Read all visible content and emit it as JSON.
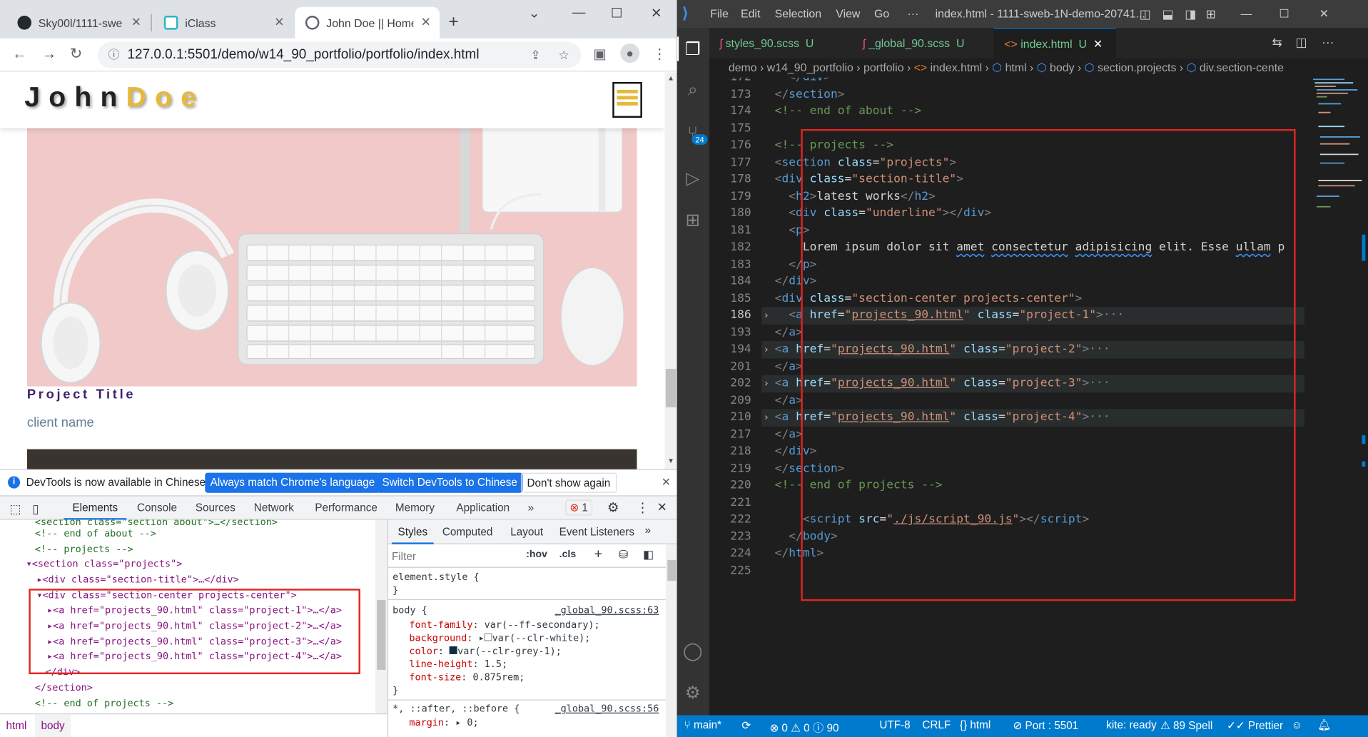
{
  "chrome": {
    "tabs": [
      {
        "title": "Sky00l/1111-swe"
      },
      {
        "title": "iClass"
      },
      {
        "title": "John Doe || Home"
      }
    ],
    "url": "127.0.0.1:5501/demo/w14_90_portfolio/portfolio/index.html",
    "site": {
      "logo_first": "John",
      "logo_last": "Doe",
      "project_title": "Project Title",
      "client_name": "client name"
    },
    "devtools": {
      "banner_text": "DevTools is now available in Chinese!",
      "banner_btn1": "Always match Chrome's language",
      "banner_btn2": "Switch DevTools to Chinese",
      "banner_btn3": "Don't show again",
      "tabs": [
        "Elements",
        "Console",
        "Sources",
        "Network",
        "Performance",
        "Memory",
        "Application"
      ],
      "more_tabs": "»",
      "error_count": "1",
      "dom_lines": [
        {
          "a": "<!-- end of about -->"
        },
        {
          "a": "<!-- projects -->"
        },
        {
          "a": "<section class=\"projects\">"
        },
        {
          "a": "<div class=\"section-title\">…</div>"
        },
        {
          "a": "<div class=\"section-center projects-center\">"
        },
        {
          "a": "<a href=\"projects_90.html\" class=\"project-1\">…</a>"
        },
        {
          "a": "<a href=\"projects_90.html\" class=\"project-2\">…</a>"
        },
        {
          "a": "<a href=\"projects_90.html\" class=\"project-3\">…</a>"
        },
        {
          "a": "<a href=\"projects_90.html\" class=\"project-4\">…</a>"
        },
        {
          "a": "</div>"
        },
        {
          "a": "</section>"
        },
        {
          "a": "<!-- end of projects -->"
        }
      ],
      "crumbs": [
        "html",
        "body"
      ],
      "style_tabs": [
        "Styles",
        "Computed",
        "Layout",
        "Event Listeners"
      ],
      "filter_placeholder": "Filter",
      "hov": ":hov",
      "cls": ".cls",
      "element_style": "element.style {",
      "rule1_selector": "body {",
      "rule1_source": "_global_90.scss:63",
      "rule1_props": [
        {
          "name": "font-family",
          "value": "var(--ff-secondary);"
        },
        {
          "name": "background",
          "value": "var(--clr-white);"
        },
        {
          "name": "color",
          "value": "var(--clr-grey-1);"
        },
        {
          "name": "line-height",
          "value": "1.5;"
        },
        {
          "name": "font-size",
          "value": "0.875rem;"
        }
      ],
      "rule2_selector": "*, ::after, ::before {",
      "rule2_source": "_global_90.scss:56",
      "rule2_props": [
        {
          "name": "margin",
          "value": "0;"
        }
      ]
    }
  },
  "vscode": {
    "menu": [
      "File",
      "Edit",
      "Selection",
      "View",
      "Go",
      "···"
    ],
    "title": "index.html - 1111-sweb-1N-demo-20741...",
    "tabs": [
      {
        "name": "styles_90.scss",
        "badge": "U"
      },
      {
        "name": "_global_90.scss",
        "badge": "U"
      },
      {
        "name": "index.html",
        "badge": "U"
      }
    ],
    "breadcrumb": [
      "demo",
      "w14_90_portfolio",
      "portfolio",
      "index.html",
      "html",
      "body",
      "section.projects",
      "div.section-cente"
    ],
    "source_control_badge": "24",
    "line_numbers": [
      "172",
      "173",
      "174",
      "175",
      "176",
      "177",
      "178",
      "179",
      "180",
      "181",
      "182",
      "183",
      "184",
      "185",
      "186",
      "193",
      "194",
      "201",
      "202",
      "209",
      "210",
      "217",
      "218",
      "219",
      "220",
      "221",
      "222",
      "223",
      "224",
      "225"
    ],
    "status": {
      "branch": "main*",
      "problems": "0",
      "warnings": "0",
      "info": "90",
      "encoding": "UTF-8",
      "eol": "CRLF",
      "language": "html",
      "port": "Port : 5501",
      "kite": "kite: ready",
      "spell": "89 Spell",
      "prettier": "Prettier"
    }
  }
}
